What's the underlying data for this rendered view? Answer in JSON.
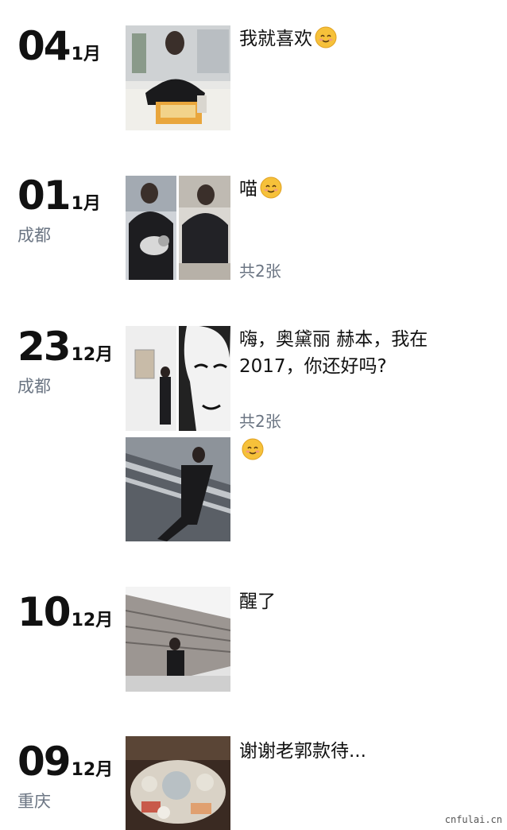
{
  "posts": [
    {
      "day": "04",
      "month": "1月",
      "location": "",
      "text": "我就喜欢",
      "emoji": "smiling-face-icon",
      "count": ""
    },
    {
      "day": "01",
      "month": "1月",
      "location": "成都",
      "text": "喵",
      "emoji": "smiling-face-icon",
      "count": "共2张"
    },
    {
      "day": "23",
      "month": "12月",
      "location": "成都",
      "text": "嗨，奥黛丽 赫本，我在2017，你还好吗?",
      "count": "共2张",
      "second_text": "",
      "second_emoji": "smiling-face-icon"
    },
    {
      "day": "10",
      "month": "12月",
      "location": "",
      "text": "醒了",
      "count": ""
    },
    {
      "day": "09",
      "month": "12月",
      "location": "重庆",
      "text": "谢谢老郭款待...",
      "count": ""
    }
  ],
  "watermark": "cnfulai.cn",
  "colors": {
    "text": "#111111",
    "secondary": "#6b7583",
    "emoji": "#f6c13a"
  }
}
